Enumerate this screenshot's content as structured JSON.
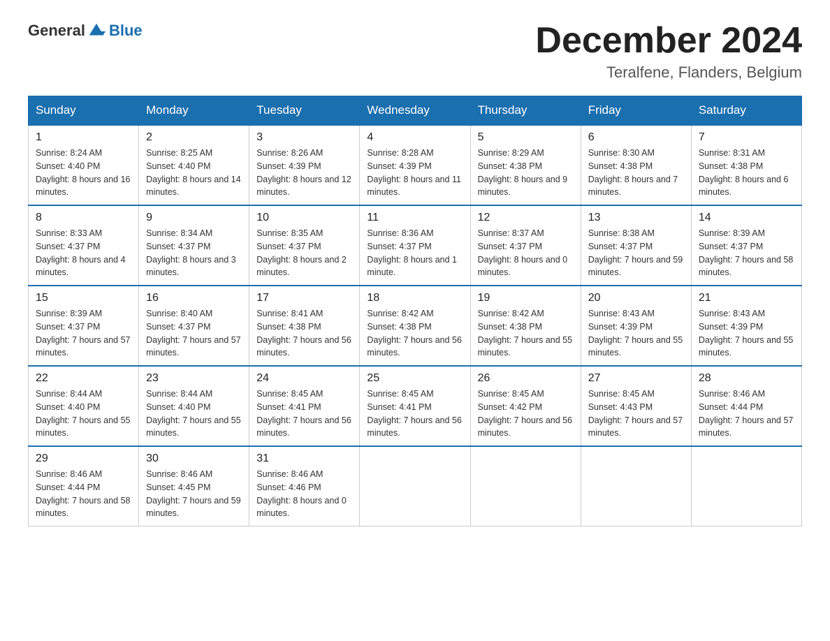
{
  "header": {
    "logo_general": "General",
    "logo_blue": "Blue",
    "month_title": "December 2024",
    "location": "Teralfene, Flanders, Belgium"
  },
  "days_of_week": [
    "Sunday",
    "Monday",
    "Tuesday",
    "Wednesday",
    "Thursday",
    "Friday",
    "Saturday"
  ],
  "weeks": [
    [
      {
        "day": "1",
        "sunrise": "8:24 AM",
        "sunset": "4:40 PM",
        "daylight": "8 hours and 16 minutes."
      },
      {
        "day": "2",
        "sunrise": "8:25 AM",
        "sunset": "4:40 PM",
        "daylight": "8 hours and 14 minutes."
      },
      {
        "day": "3",
        "sunrise": "8:26 AM",
        "sunset": "4:39 PM",
        "daylight": "8 hours and 12 minutes."
      },
      {
        "day": "4",
        "sunrise": "8:28 AM",
        "sunset": "4:39 PM",
        "daylight": "8 hours and 11 minutes."
      },
      {
        "day": "5",
        "sunrise": "8:29 AM",
        "sunset": "4:38 PM",
        "daylight": "8 hours and 9 minutes."
      },
      {
        "day": "6",
        "sunrise": "8:30 AM",
        "sunset": "4:38 PM",
        "daylight": "8 hours and 7 minutes."
      },
      {
        "day": "7",
        "sunrise": "8:31 AM",
        "sunset": "4:38 PM",
        "daylight": "8 hours and 6 minutes."
      }
    ],
    [
      {
        "day": "8",
        "sunrise": "8:33 AM",
        "sunset": "4:37 PM",
        "daylight": "8 hours and 4 minutes."
      },
      {
        "day": "9",
        "sunrise": "8:34 AM",
        "sunset": "4:37 PM",
        "daylight": "8 hours and 3 minutes."
      },
      {
        "day": "10",
        "sunrise": "8:35 AM",
        "sunset": "4:37 PM",
        "daylight": "8 hours and 2 minutes."
      },
      {
        "day": "11",
        "sunrise": "8:36 AM",
        "sunset": "4:37 PM",
        "daylight": "8 hours and 1 minute."
      },
      {
        "day": "12",
        "sunrise": "8:37 AM",
        "sunset": "4:37 PM",
        "daylight": "8 hours and 0 minutes."
      },
      {
        "day": "13",
        "sunrise": "8:38 AM",
        "sunset": "4:37 PM",
        "daylight": "7 hours and 59 minutes."
      },
      {
        "day": "14",
        "sunrise": "8:39 AM",
        "sunset": "4:37 PM",
        "daylight": "7 hours and 58 minutes."
      }
    ],
    [
      {
        "day": "15",
        "sunrise": "8:39 AM",
        "sunset": "4:37 PM",
        "daylight": "7 hours and 57 minutes."
      },
      {
        "day": "16",
        "sunrise": "8:40 AM",
        "sunset": "4:37 PM",
        "daylight": "7 hours and 57 minutes."
      },
      {
        "day": "17",
        "sunrise": "8:41 AM",
        "sunset": "4:38 PM",
        "daylight": "7 hours and 56 minutes."
      },
      {
        "day": "18",
        "sunrise": "8:42 AM",
        "sunset": "4:38 PM",
        "daylight": "7 hours and 56 minutes."
      },
      {
        "day": "19",
        "sunrise": "8:42 AM",
        "sunset": "4:38 PM",
        "daylight": "7 hours and 55 minutes."
      },
      {
        "day": "20",
        "sunrise": "8:43 AM",
        "sunset": "4:39 PM",
        "daylight": "7 hours and 55 minutes."
      },
      {
        "day": "21",
        "sunrise": "8:43 AM",
        "sunset": "4:39 PM",
        "daylight": "7 hours and 55 minutes."
      }
    ],
    [
      {
        "day": "22",
        "sunrise": "8:44 AM",
        "sunset": "4:40 PM",
        "daylight": "7 hours and 55 minutes."
      },
      {
        "day": "23",
        "sunrise": "8:44 AM",
        "sunset": "4:40 PM",
        "daylight": "7 hours and 55 minutes."
      },
      {
        "day": "24",
        "sunrise": "8:45 AM",
        "sunset": "4:41 PM",
        "daylight": "7 hours and 56 minutes."
      },
      {
        "day": "25",
        "sunrise": "8:45 AM",
        "sunset": "4:41 PM",
        "daylight": "7 hours and 56 minutes."
      },
      {
        "day": "26",
        "sunrise": "8:45 AM",
        "sunset": "4:42 PM",
        "daylight": "7 hours and 56 minutes."
      },
      {
        "day": "27",
        "sunrise": "8:45 AM",
        "sunset": "4:43 PM",
        "daylight": "7 hours and 57 minutes."
      },
      {
        "day": "28",
        "sunrise": "8:46 AM",
        "sunset": "4:44 PM",
        "daylight": "7 hours and 57 minutes."
      }
    ],
    [
      {
        "day": "29",
        "sunrise": "8:46 AM",
        "sunset": "4:44 PM",
        "daylight": "7 hours and 58 minutes."
      },
      {
        "day": "30",
        "sunrise": "8:46 AM",
        "sunset": "4:45 PM",
        "daylight": "7 hours and 59 minutes."
      },
      {
        "day": "31",
        "sunrise": "8:46 AM",
        "sunset": "4:46 PM",
        "daylight": "8 hours and 0 minutes."
      },
      null,
      null,
      null,
      null
    ]
  ]
}
